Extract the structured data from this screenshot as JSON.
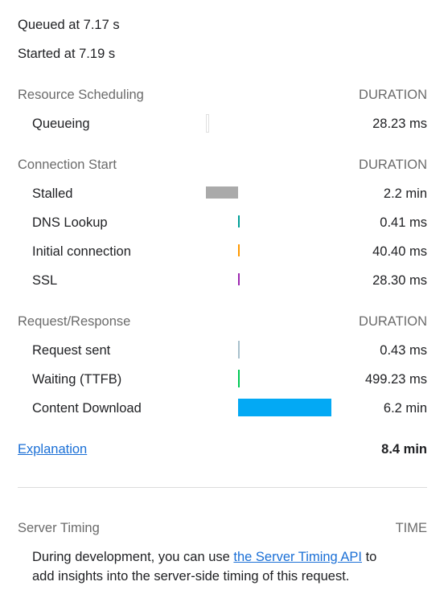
{
  "queued": "Queued at 7.17 s",
  "started": "Started at 7.19 s",
  "sections": [
    {
      "title": "Resource Scheduling",
      "col": "DURATION",
      "rows": [
        {
          "label": "Queueing",
          "value": "28.23 ms",
          "color": "#e0e0e0"
        }
      ]
    },
    {
      "title": "Connection Start",
      "col": "DURATION",
      "rows": [
        {
          "label": "Stalled",
          "value": "2.2 min",
          "color": "#aaaaaa"
        },
        {
          "label": "DNS Lookup",
          "value": "0.41 ms",
          "color": "#009f97"
        },
        {
          "label": "Initial connection",
          "value": "40.40 ms",
          "color": "#ff9800"
        },
        {
          "label": "SSL",
          "value": "28.30 ms",
          "color": "#9c27b0"
        }
      ]
    },
    {
      "title": "Request/Response",
      "col": "DURATION",
      "rows": [
        {
          "label": "Request sent",
          "value": "0.43 ms",
          "color": "#a8c0cc"
        },
        {
          "label": "Waiting (TTFB)",
          "value": "499.23 ms",
          "color": "#00c853"
        },
        {
          "label": "Content Download",
          "value": "6.2 min",
          "color": "#03a9f4"
        }
      ]
    }
  ],
  "explanation": "Explanation",
  "total": "8.4 min",
  "server": {
    "title": "Server Timing",
    "col": "TIME",
    "text1": "During development, you can use ",
    "link": "the Server Timing API",
    "text2": " to",
    "text3": "add insights into the server-side timing of this request."
  }
}
